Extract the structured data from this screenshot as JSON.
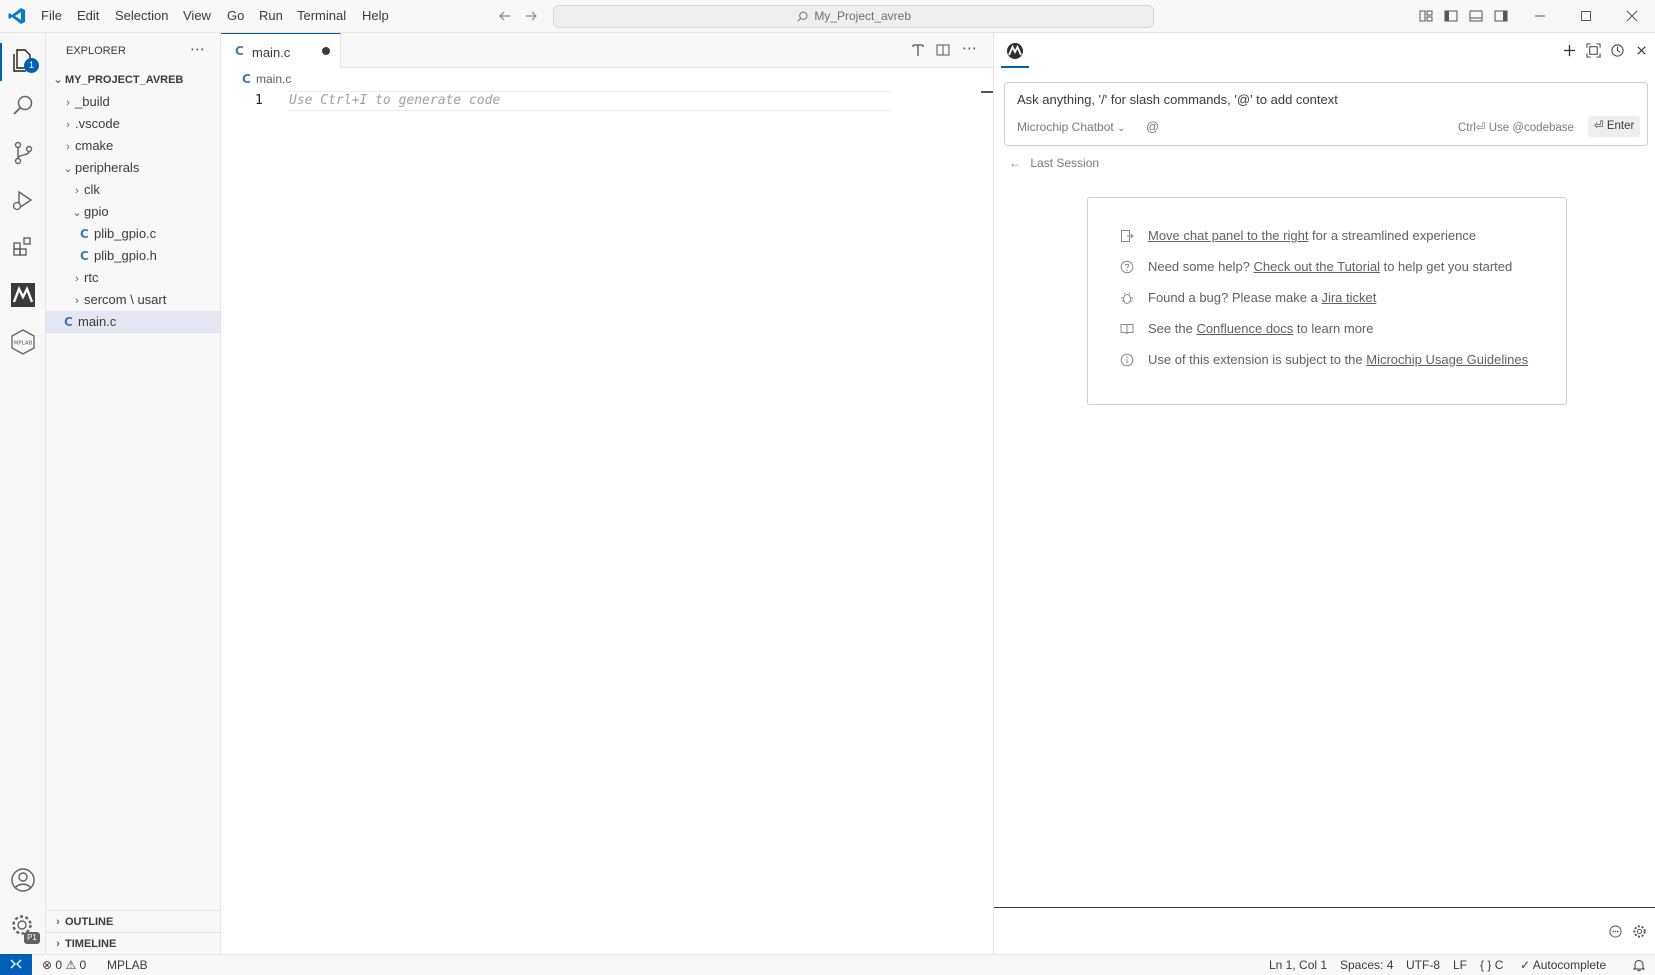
{
  "titlebar": {
    "menus": [
      "File",
      "Edit",
      "Selection",
      "View",
      "Go",
      "Run",
      "Terminal",
      "Help"
    ],
    "search_text": "My_Project_avreb"
  },
  "activity": {
    "explorer_badge": "1",
    "settings_badge": "P1"
  },
  "sidebar": {
    "title": "EXPLORER",
    "project": "MY_PROJECT_AVREB",
    "items": [
      {
        "label": "_build",
        "type": "folder"
      },
      {
        "label": ".vscode",
        "type": "folder"
      },
      {
        "label": "cmake",
        "type": "folder"
      },
      {
        "label": "peripherals",
        "type": "folder-open"
      },
      {
        "label": "clk",
        "type": "folder"
      },
      {
        "label": "gpio",
        "type": "folder-open"
      },
      {
        "label": "plib_gpio.c",
        "type": "file"
      },
      {
        "label": "plib_gpio.h",
        "type": "file"
      },
      {
        "label": "rtc",
        "type": "folder"
      },
      {
        "label": "sercom \\ usart",
        "type": "folder"
      },
      {
        "label": "main.c",
        "type": "file"
      }
    ],
    "outline": "OUTLINE",
    "timeline": "TIMELINE"
  },
  "editor": {
    "tab_label": "main.c",
    "breadcrumb": "main.c",
    "line_number": "1",
    "placeholder": "Use Ctrl+I to generate code"
  },
  "chat": {
    "input_placeholder": "Ask anything, '/' for slash commands, '@' to add context",
    "model": "Microchip Chatbot",
    "at_symbol": "@",
    "shortcut_hint": "Ctrl⏎ Use @codebase",
    "enter_label": "⏎ Enter",
    "last_session": "Last Session",
    "tips": [
      {
        "before": "",
        "link": "Move chat panel to the right",
        "after": " for a streamlined experience",
        "icon": "move-panel-icon"
      },
      {
        "before": "Need some help? ",
        "link": "Check out the Tutorial",
        "after": " to help get you started",
        "icon": "help-circle-icon"
      },
      {
        "before": "Found a bug? Please make a ",
        "link": "Jira ticket",
        "after": "",
        "icon": "bug-icon"
      },
      {
        "before": "See the ",
        "link": "Confluence docs",
        "after": " to learn more",
        "icon": "book-icon"
      },
      {
        "before": "Use of this extension is subject to the ",
        "link": "Microchip Usage Guidelines",
        "after": "",
        "icon": "info-icon"
      }
    ]
  },
  "statusbar": {
    "errors": "0",
    "warnings": "0",
    "mplab": "MPLAB",
    "position": "Ln 1, Col 1",
    "spaces": "Spaces: 4",
    "encoding": "UTF-8",
    "eol": "LF",
    "language": "C",
    "autocomplete": "Autocomplete"
  },
  "colors": {
    "accent": "#005fb8",
    "c_file": "#3d7bb8"
  }
}
